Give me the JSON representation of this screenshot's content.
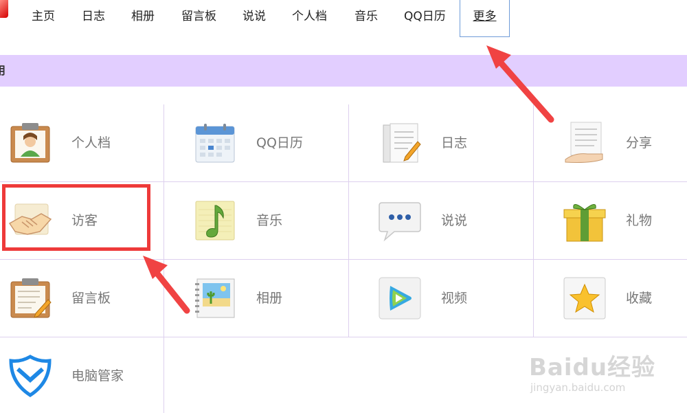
{
  "nav": {
    "items": [
      "主页",
      "日志",
      "相册",
      "留言板",
      "说说",
      "个人档",
      "音乐",
      "QQ日历"
    ],
    "more": "更多"
  },
  "section": {
    "title": "用"
  },
  "apps": [
    {
      "label": "个人档",
      "icon": "profile-clipboard-icon"
    },
    {
      "label": "QQ日历",
      "icon": "calendar-icon"
    },
    {
      "label": "日志",
      "icon": "journal-icon"
    },
    {
      "label": "分享",
      "icon": "share-icon"
    },
    {
      "label": "访客",
      "icon": "handshake-icon"
    },
    {
      "label": "音乐",
      "icon": "music-note-icon"
    },
    {
      "label": "说说",
      "icon": "speech-bubble-icon"
    },
    {
      "label": "礼物",
      "icon": "gift-icon"
    },
    {
      "label": "留言板",
      "icon": "message-board-icon"
    },
    {
      "label": "相册",
      "icon": "photo-album-icon"
    },
    {
      "label": "视频",
      "icon": "video-play-icon"
    },
    {
      "label": "收藏",
      "icon": "star-icon"
    },
    {
      "label": "电脑管家",
      "icon": "shield-icon"
    }
  ],
  "watermark": {
    "main": "Baidu经验",
    "sub": "jingyan.baidu.com"
  },
  "colors": {
    "section_bar": "#e2ceff",
    "highlight": "#ee3a3a",
    "grid_line": "#ddd0ee",
    "nav_active_border": "#6e9bd8"
  }
}
